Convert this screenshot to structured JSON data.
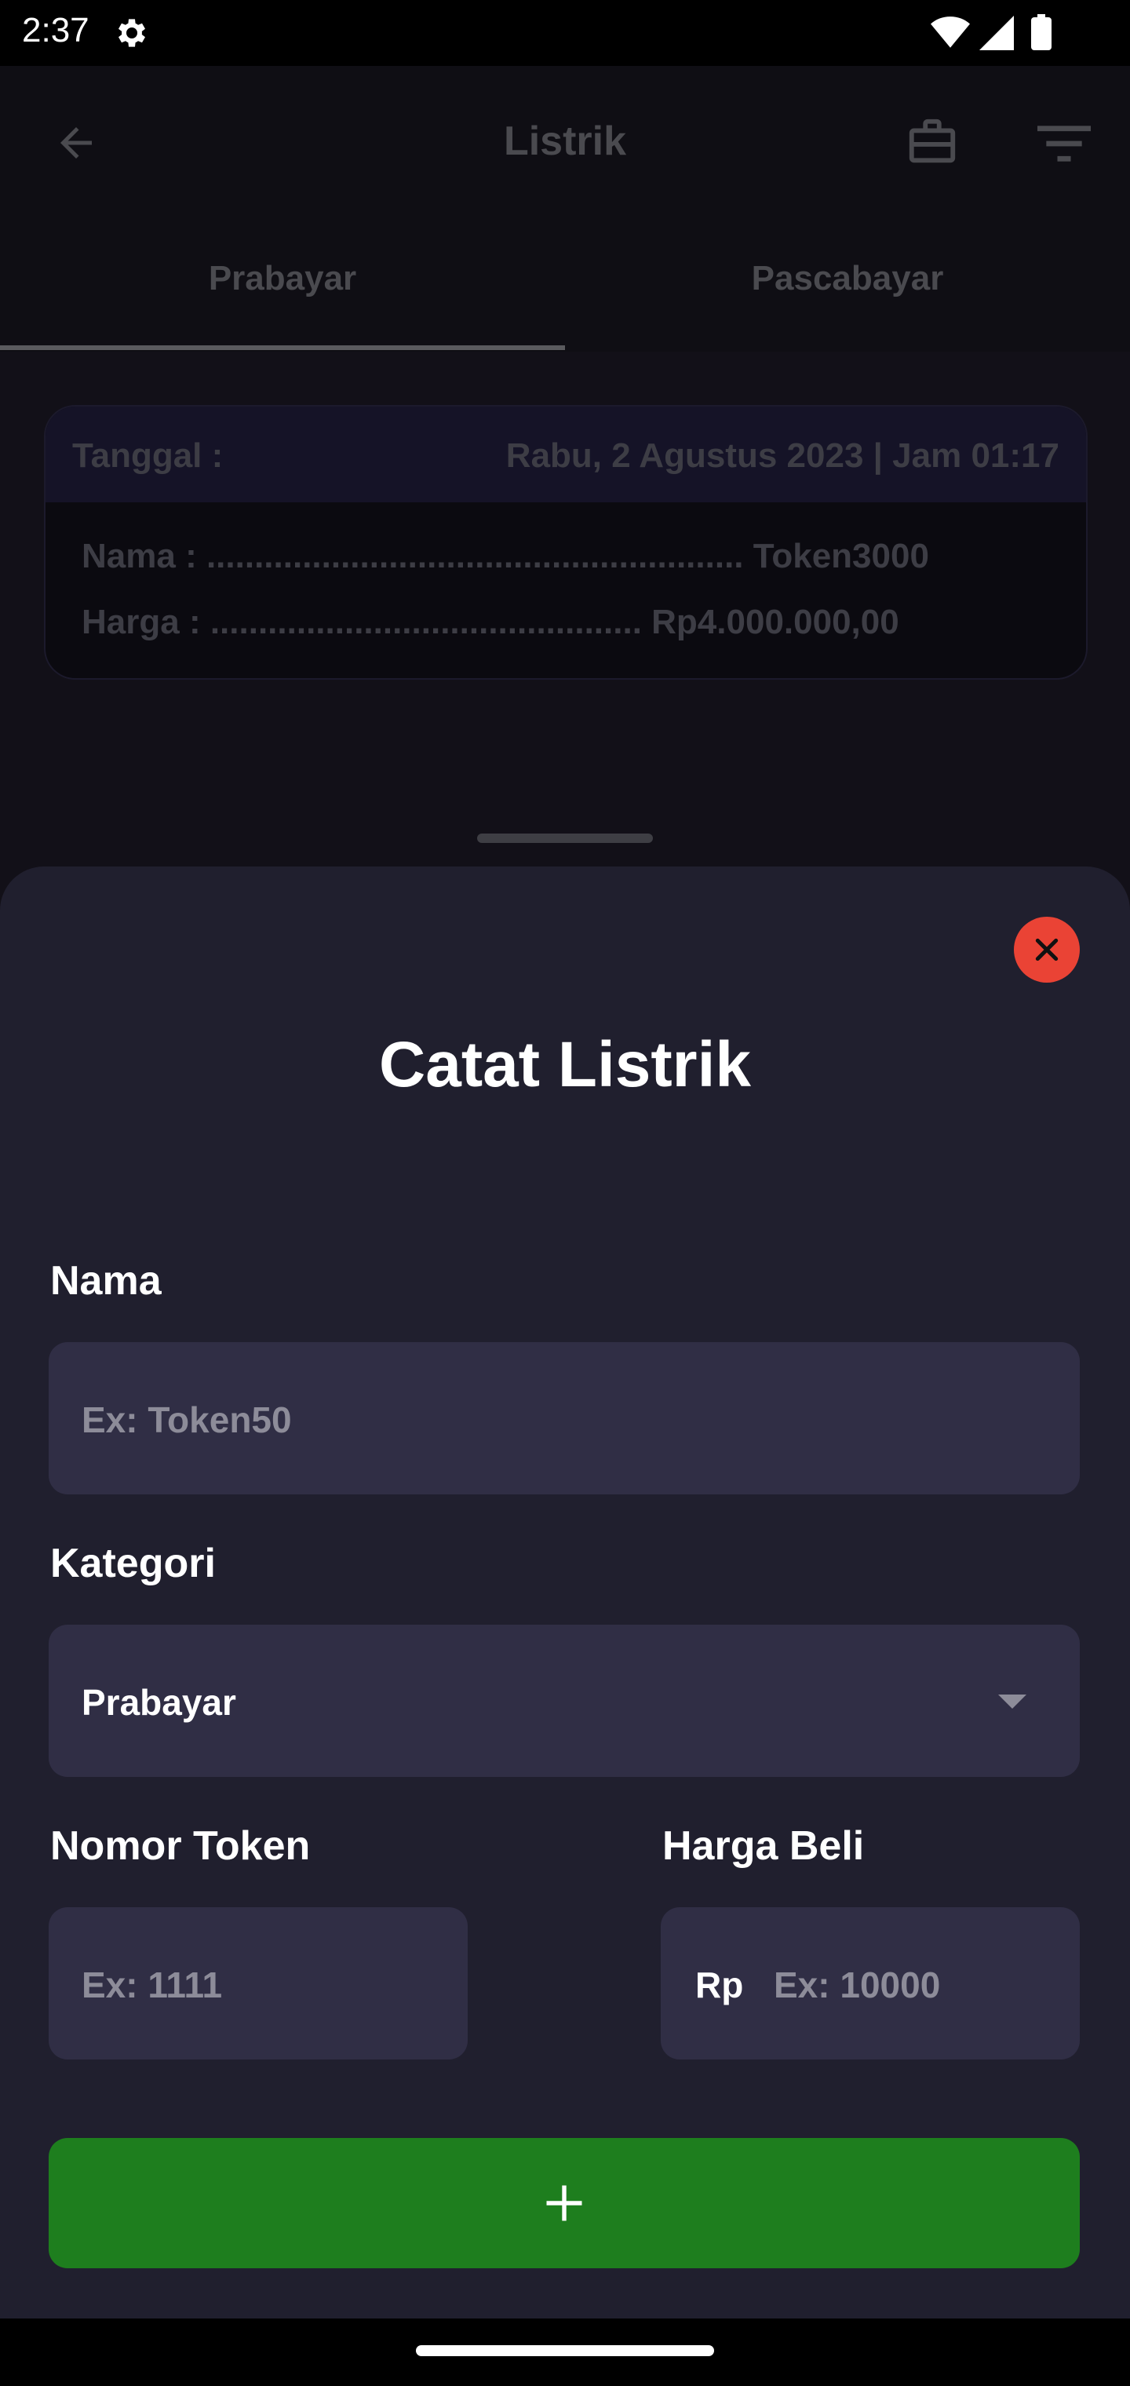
{
  "status_bar": {
    "time": "2:37"
  },
  "app_bar": {
    "title": "Listrik"
  },
  "tabs": [
    {
      "label": "Prabayar",
      "active": true
    },
    {
      "label": "Pascabayar",
      "active": false
    }
  ],
  "card": {
    "date_label": "Tanggal :",
    "date_value": "Rabu, 2 Agustus 2023 | Jam 01:17",
    "name_row": "Nama : ........................................................ Token3000",
    "price_row": "Harga : ............................................. Rp4.000.000,00"
  },
  "sheet": {
    "title": "Catat Listrik",
    "name_label": "Nama",
    "name_placeholder": "Ex: Token50",
    "category_label": "Kategori",
    "category_value": "Prabayar",
    "token_label": "Nomor Token",
    "token_placeholder": "Ex: 1111",
    "price_label": "Harga Beli",
    "price_prefix": "Rp",
    "price_placeholder": "Ex: 10000"
  },
  "colors": {
    "sheet_bg": "#201f2e",
    "field_bg": "#302e45",
    "add_button": "#1e7e1e",
    "close_button": "#ea4335"
  },
  "icons": [
    "settings-icon",
    "wifi-icon",
    "signal-icon",
    "battery-icon",
    "back-arrow-icon",
    "briefcase-icon",
    "filter-icon",
    "close-icon",
    "dropdown-arrow-icon",
    "plus-icon"
  ]
}
